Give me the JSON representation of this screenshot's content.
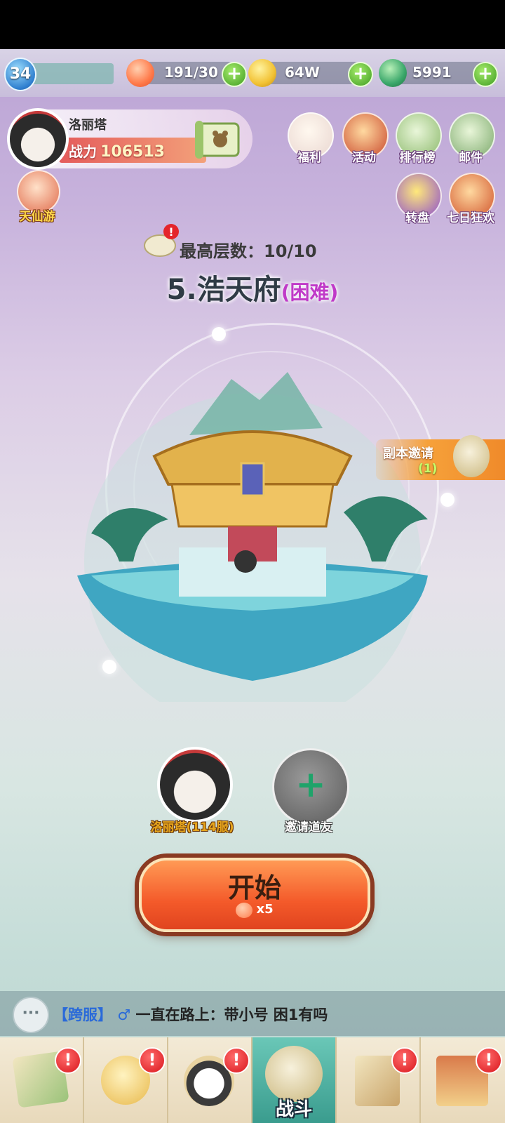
{
  "resources": {
    "level": "34",
    "stamina": "191/30",
    "coins": "64W",
    "jade": "5991"
  },
  "player": {
    "name": "洛丽塔",
    "power_label": "战力",
    "power_value": "106513"
  },
  "top_icons": [
    {
      "label": "福利",
      "icon": "gift-scroll-icon"
    },
    {
      "label": "活动",
      "icon": "drum-icon"
    },
    {
      "label": "排行榜",
      "icon": "ranking-pavilion-icon"
    },
    {
      "label": "邮件",
      "icon": "mail-gate-icon"
    },
    {
      "label": "转盘",
      "icon": "wheel-icon"
    },
    {
      "label": "七日狂欢",
      "icon": "treasure-icon"
    }
  ],
  "left_icon": {
    "label": "天仙游",
    "icon": "gourd-icon"
  },
  "floor": {
    "label": "最高层数：10/10"
  },
  "stage": {
    "title": "5.浩天府",
    "difficulty": "(困难)"
  },
  "invite_tab": {
    "label": "副本邀请",
    "count": "(1)"
  },
  "team": {
    "member_label": "洛丽塔(114服)",
    "invite_label": "邀请道友"
  },
  "start": {
    "label": "开始",
    "cost": "x5"
  },
  "chat": {
    "channel": "【跨服】",
    "gender": "♂",
    "message": "一直在路上：带小号 困1有吗"
  },
  "nav": {
    "badge": "!",
    "active_label": "战斗"
  },
  "colors": {
    "accent": "#f45a2a",
    "stamina": "#ff8a5c",
    "coin": "#f2c234",
    "jade": "#3aa76a",
    "difficulty": "#c03ac8"
  }
}
